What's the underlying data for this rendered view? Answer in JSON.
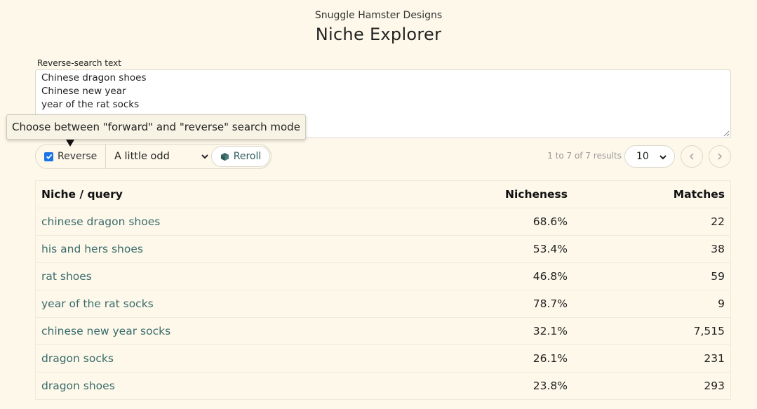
{
  "header": {
    "brand": "Snuggle Hamster Designs",
    "title": "Niche Explorer"
  },
  "search": {
    "label": "Reverse-search text",
    "value": "Chinese dragon shoes\nChinese new year\nyear of the rat socks"
  },
  "tooltip": {
    "text": "Choose between \"forward\" and \"reverse\" search mode"
  },
  "controls": {
    "reverse_label": "Reverse",
    "reverse_checked": true,
    "mode_selected": "A little odd",
    "reroll_label": "Reroll"
  },
  "pagination": {
    "results_text": "1 to 7 of 7 results",
    "page_size": "10"
  },
  "table": {
    "headers": {
      "niche": "Niche / query",
      "nicheness": "Nicheness",
      "matches": "Matches"
    },
    "rows": [
      {
        "niche": "chinese dragon shoes",
        "nicheness": "68.6%",
        "matches": "22"
      },
      {
        "niche": "his and hers shoes",
        "nicheness": "53.4%",
        "matches": "38"
      },
      {
        "niche": "rat shoes",
        "nicheness": "46.8%",
        "matches": "59"
      },
      {
        "niche": "year of the rat socks",
        "nicheness": "78.7%",
        "matches": "9"
      },
      {
        "niche": "chinese new year socks",
        "nicheness": "32.1%",
        "matches": "7,515"
      },
      {
        "niche": "dragon socks",
        "nicheness": "26.1%",
        "matches": "231"
      },
      {
        "niche": "dragon shoes",
        "nicheness": "23.8%",
        "matches": "293"
      }
    ]
  },
  "colors": {
    "background": "#fdf8ea",
    "link": "#3a6b6b",
    "checkbox": "#1a73e8"
  }
}
